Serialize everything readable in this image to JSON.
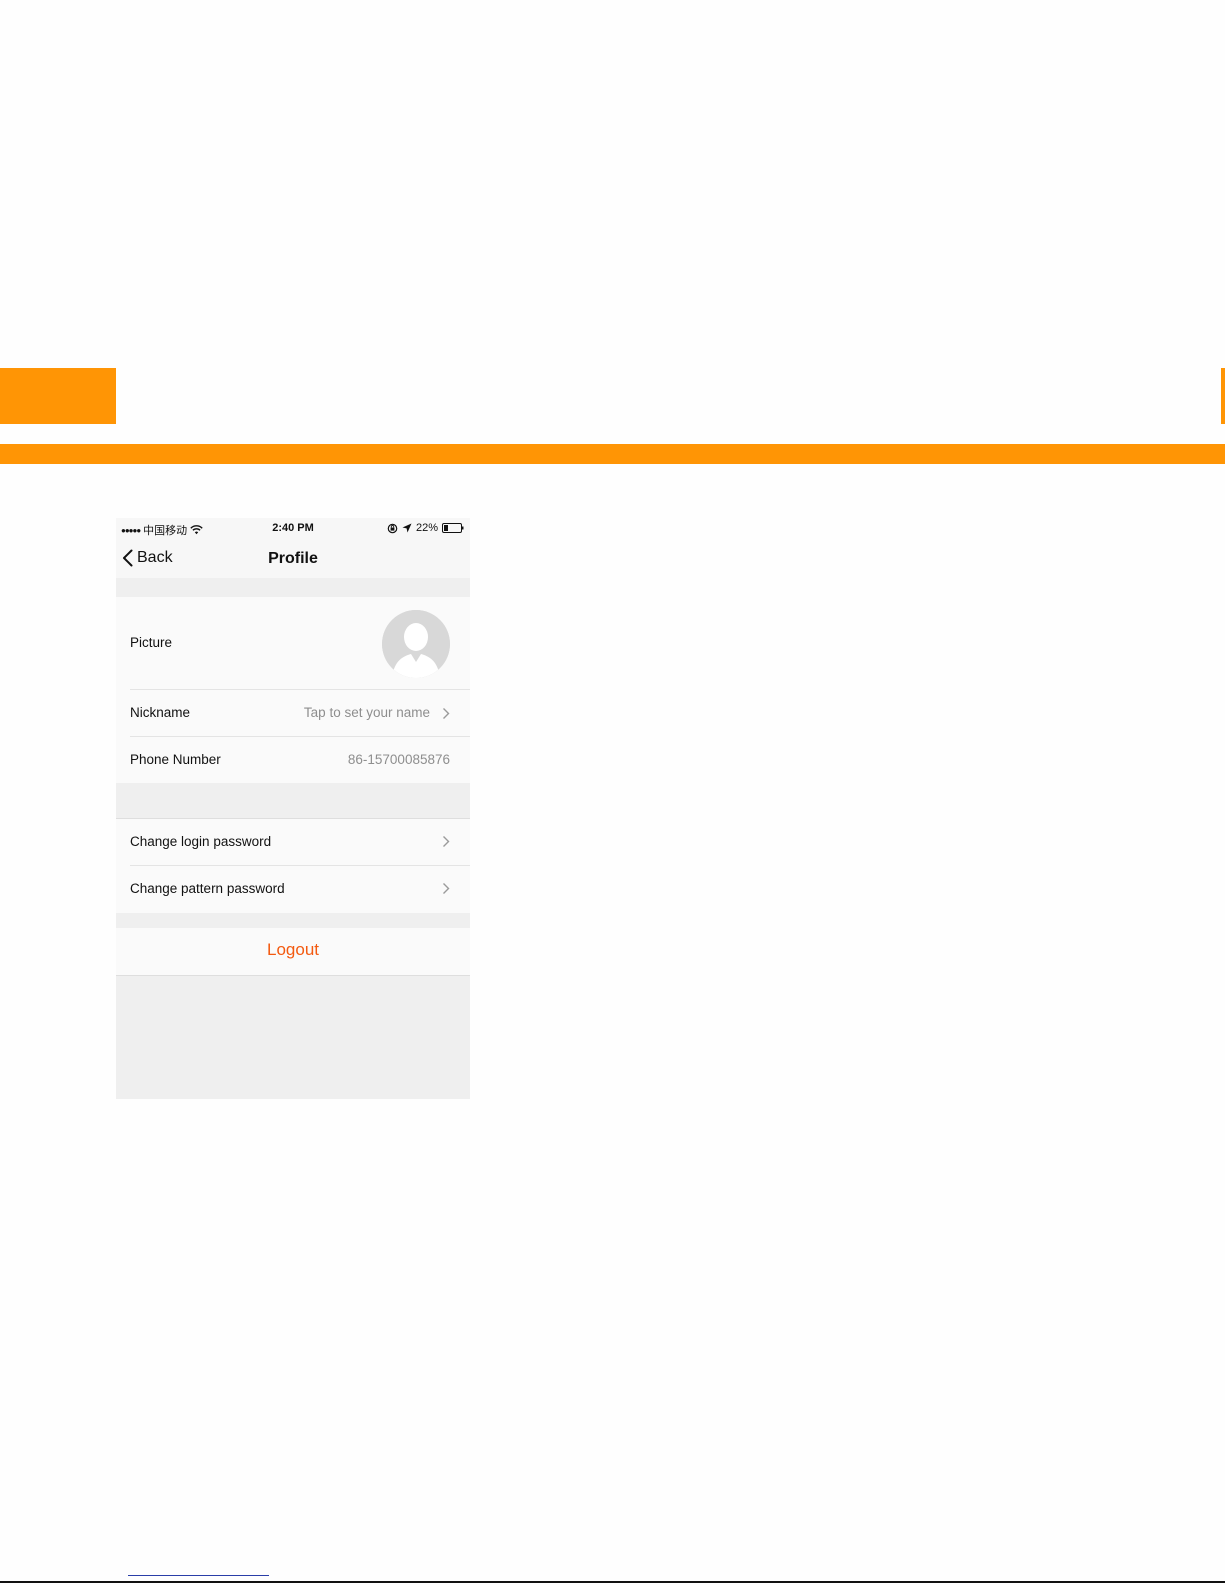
{
  "status_bar": {
    "carrier": "中国移动",
    "time": "2:40 PM",
    "battery": "22%",
    "icons": [
      "signal-dots",
      "wifi-icon",
      "lock-rotation-icon",
      "location-arrow-icon",
      "battery-icon"
    ]
  },
  "nav": {
    "back_label": "Back",
    "title": "Profile"
  },
  "profile": {
    "picture_label": "Picture",
    "avatar_icon": "default-avatar-icon",
    "nickname_label": "Nickname",
    "nickname_placeholder": "Tap to set your name",
    "phone_label": "Phone Number",
    "phone_value": "86-15700085876"
  },
  "security": {
    "change_login_label": "Change login password",
    "change_pattern_label": "Change pattern password"
  },
  "actions": {
    "logout_label": "Logout"
  },
  "colors": {
    "accent_orange": "#ff9505",
    "logout_text": "#f35a10",
    "group_background": "#efefef",
    "cell_background": "#fafafa"
  }
}
